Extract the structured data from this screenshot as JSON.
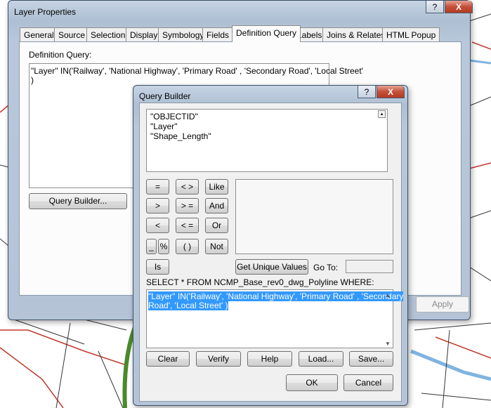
{
  "layer_properties": {
    "title": "Layer Properties",
    "help_label": "?",
    "close_label": "X",
    "tabs": [
      {
        "label": "General"
      },
      {
        "label": "Source"
      },
      {
        "label": "Selection"
      },
      {
        "label": "Display"
      },
      {
        "label": "Symbology"
      },
      {
        "label": "Fields"
      },
      {
        "label": "Definition Query"
      },
      {
        "label": "Labels"
      },
      {
        "label": "Joins & Relates"
      },
      {
        "label": "HTML Popup"
      }
    ],
    "active_tab": "Definition Query",
    "definition_query_label": "Definition Query:",
    "definition_query_lines": [
      "\"Layer\" IN('Railway', 'National Highway', 'Primary Road' , 'Secondary Road', 'Local Street'",
      ")"
    ],
    "query_builder_button": "Query Builder...",
    "apply_button": "Apply"
  },
  "query_builder": {
    "title": "Query Builder",
    "help_label": "?",
    "close_label": "X",
    "fields": [
      "\"OBJECTID\"",
      "\"Layer\"",
      "\"Shape_Length\""
    ],
    "operators": {
      "eq": "=",
      "ne": "< >",
      "like": "Like",
      "gt": ">",
      "ge": "> =",
      "and": "And",
      "lt": "<",
      "le": "< =",
      "or": "Or",
      "underscore": "_",
      "percent": "%",
      "parens": "( )",
      "not": "Not",
      "is": "Is"
    },
    "get_unique_values_button": "Get Unique Values",
    "go_to_label": "Go To:",
    "go_to_value": "",
    "select_statement": "SELECT * FROM NCMP_Base_rev0_dwg_Polyline WHERE:",
    "expression_lines": [
      "\"Layer\" IN('Railway', 'National Highway', 'Primary Road' , 'Secondary",
      "Road', 'Local Street' )"
    ],
    "buttons": {
      "clear": "Clear",
      "verify": "Verify",
      "help": "Help",
      "load": "Load...",
      "save": "Save...",
      "ok": "OK",
      "cancel": "Cancel"
    }
  },
  "colors": {
    "map_green": "#4a8a2a",
    "map_road_red": "#c0392b",
    "map_water_blue": "#7fb4e0",
    "selection_blue": "#3399ff"
  }
}
